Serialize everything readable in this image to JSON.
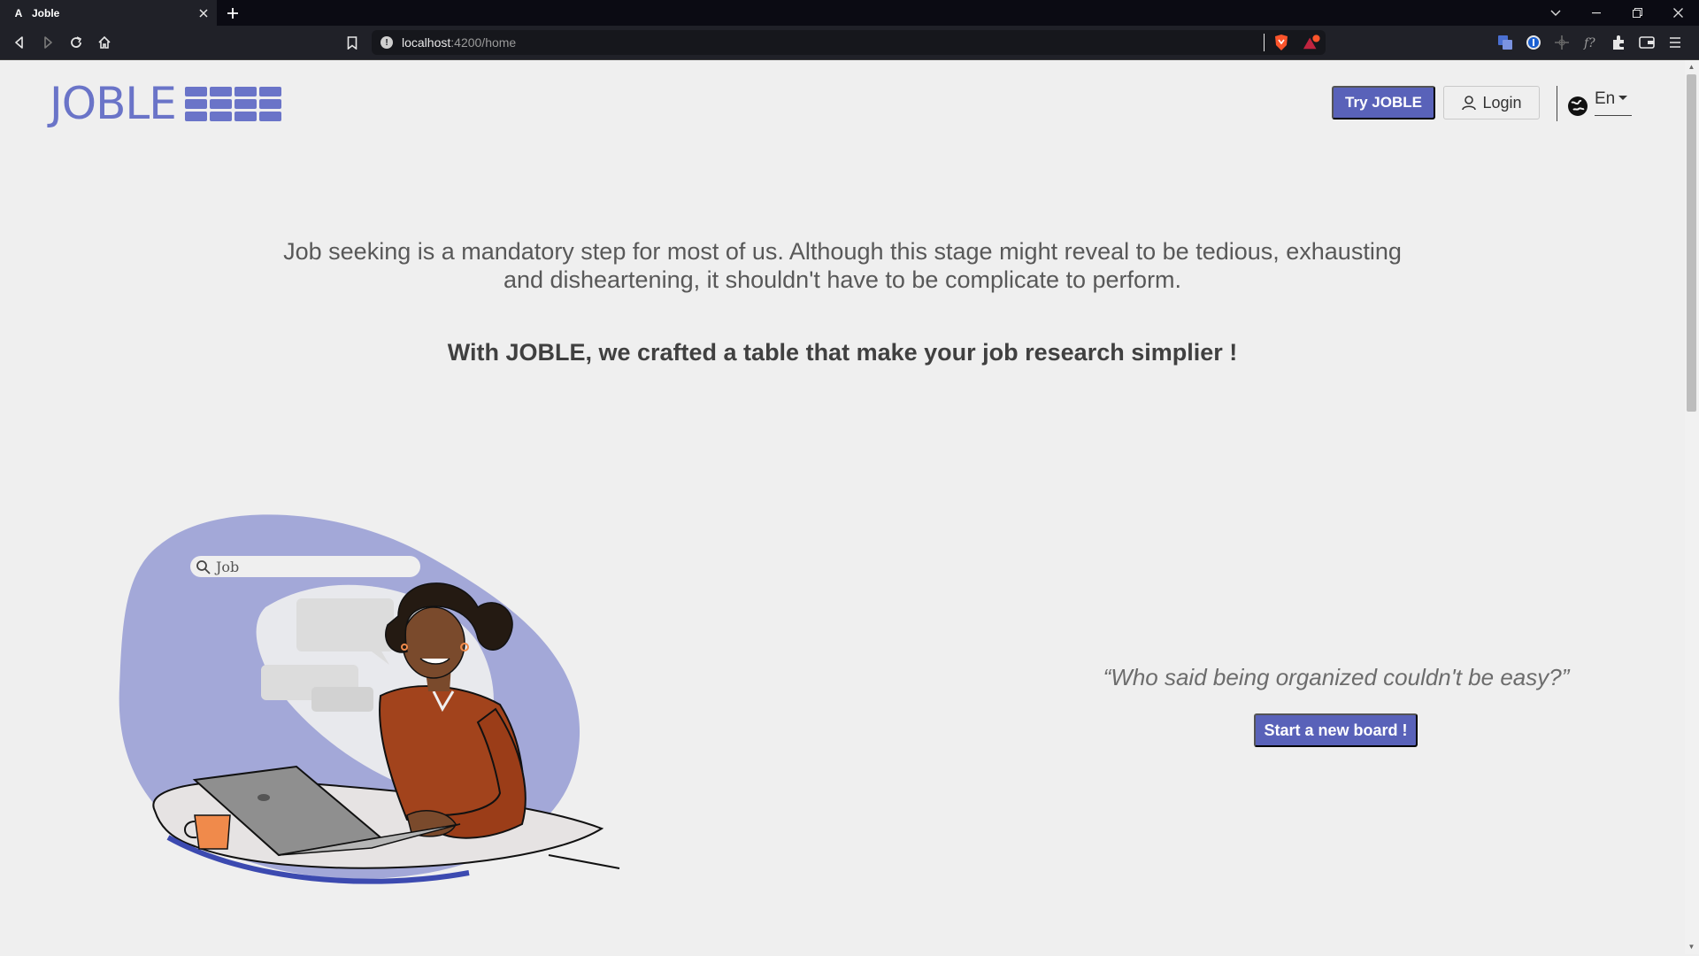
{
  "browser": {
    "tab_title": "Joble",
    "tab_favicon": "A",
    "url_host": "localhost",
    "url_path": ":4200/home",
    "icons": [
      "back-icon",
      "forward-icon",
      "reload-icon",
      "home-icon",
      "bookmark-icon",
      "info-icon",
      "brave-shield-icon",
      "brave-rewards-icon",
      "translate-icon",
      "password-manager-icon",
      "extensions-icon",
      "wallet-icon",
      "menu-icon"
    ]
  },
  "header": {
    "logo_text": "JOBLE",
    "try_button": "Try JOBLE",
    "login_button": "Login",
    "language": "En"
  },
  "hero": {
    "intro": "Job seeking is a mandatory step for most of us. Although this stage might reveal to be tedious, exhausting and disheartening, it shouldn't have to be complicate to perform.",
    "tagline": "With JOBLE, we crafted a table that make your job research simplier !"
  },
  "illustration": {
    "search_text": "Job"
  },
  "cta": {
    "quote": "“Who said being organized couldn't be easy?”",
    "start_button": "Start a new board !"
  },
  "colors": {
    "brand": "#5962b9",
    "logo": "#6a74c8",
    "blob": "#a3a8d8",
    "background": "#efefef"
  }
}
